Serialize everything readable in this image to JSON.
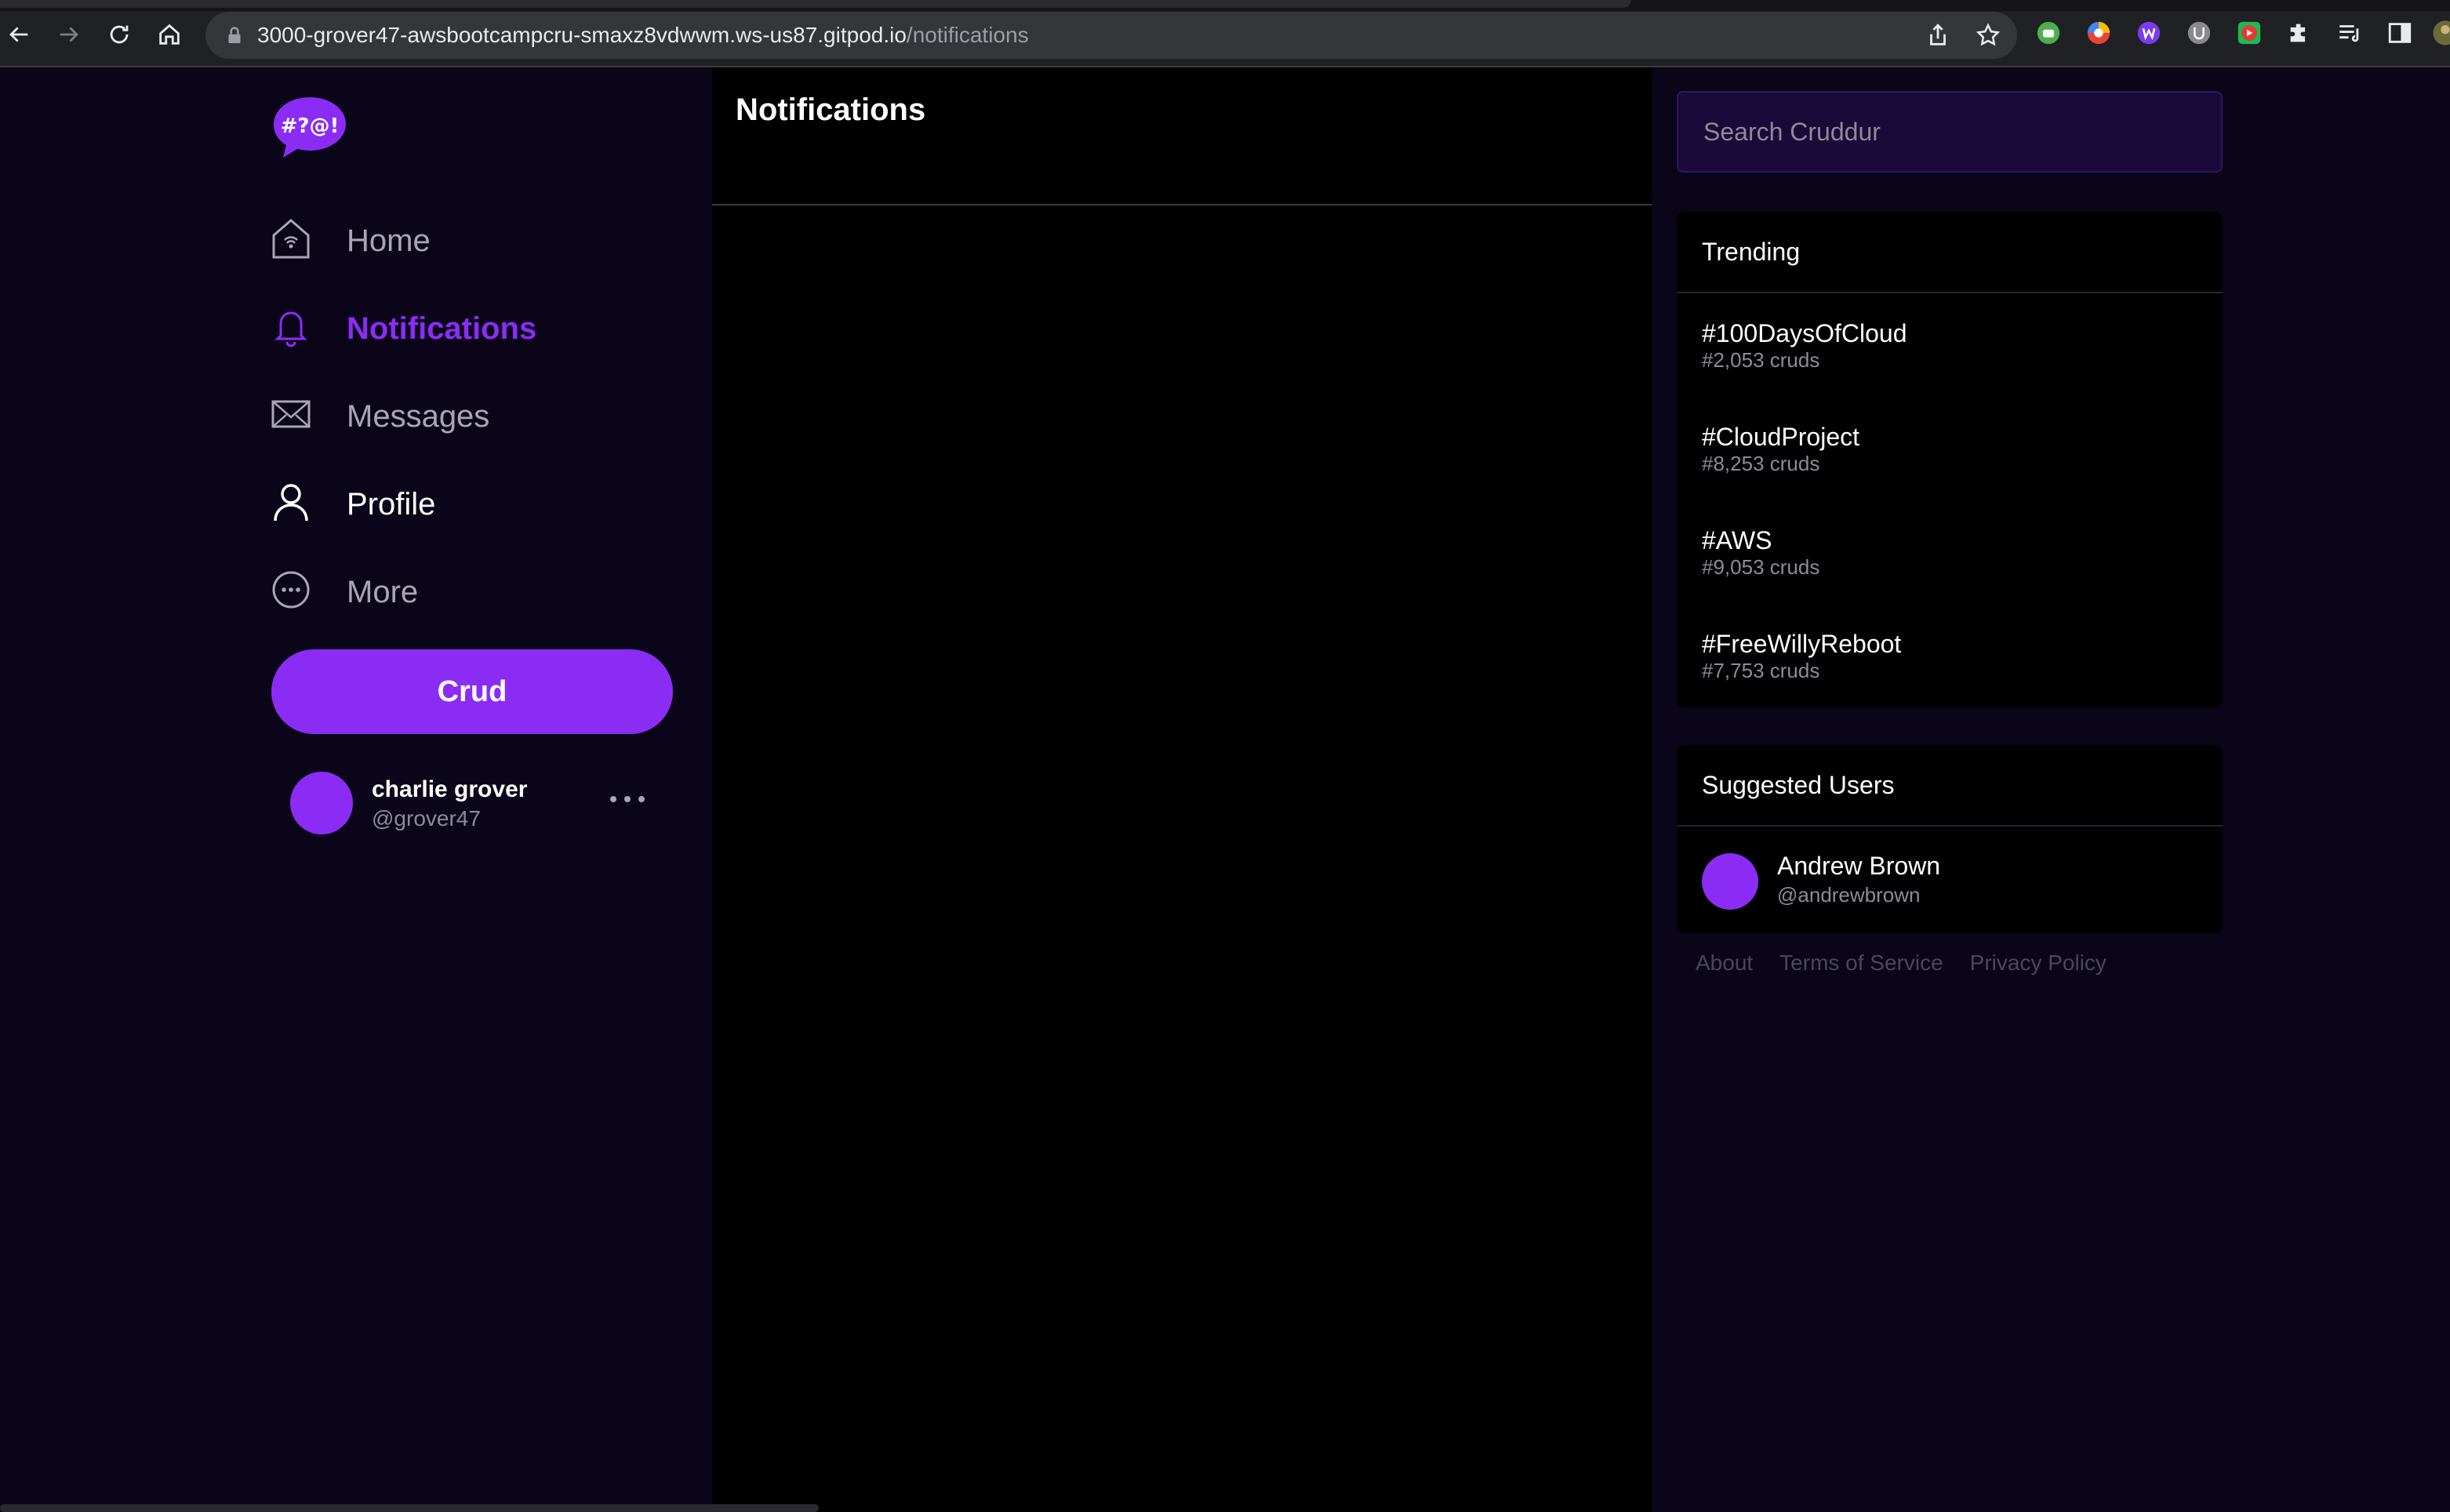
{
  "browser": {
    "url_host": "3000-grover47-awsbootcampcru-smaxz8vdwwm.ws-us87.gitpod.io",
    "url_path": "/notifications"
  },
  "app": {
    "logo_text": "#?@!",
    "brand_color": "#8b2cf5"
  },
  "sidebar": {
    "items": [
      {
        "label": "Home",
        "icon": "home-icon"
      },
      {
        "label": "Notifications",
        "icon": "bell-icon"
      },
      {
        "label": "Messages",
        "icon": "envelope-icon"
      },
      {
        "label": "Profile",
        "icon": "user-icon"
      },
      {
        "label": "More",
        "icon": "more-circle-icon"
      }
    ],
    "crud_label": "Crud",
    "current_user": {
      "name": "charlie grover",
      "handle": "@grover47"
    }
  },
  "main": {
    "title": "Notifications"
  },
  "search": {
    "placeholder": "Search Cruddur"
  },
  "trending": {
    "title": "Trending",
    "items": [
      {
        "tag": "#100DaysOfCloud",
        "count": "#2,053 cruds"
      },
      {
        "tag": "#CloudProject",
        "count": "#8,253 cruds"
      },
      {
        "tag": "#AWS",
        "count": "#9,053 cruds"
      },
      {
        "tag": "#FreeWillyReboot",
        "count": "#7,753 cruds"
      }
    ]
  },
  "suggested": {
    "title": "Suggested Users",
    "users": [
      {
        "name": "Andrew Brown",
        "handle": "@andrewbrown"
      }
    ]
  },
  "footer": {
    "links": [
      "About",
      "Terms of Service",
      "Privacy Policy"
    ]
  }
}
